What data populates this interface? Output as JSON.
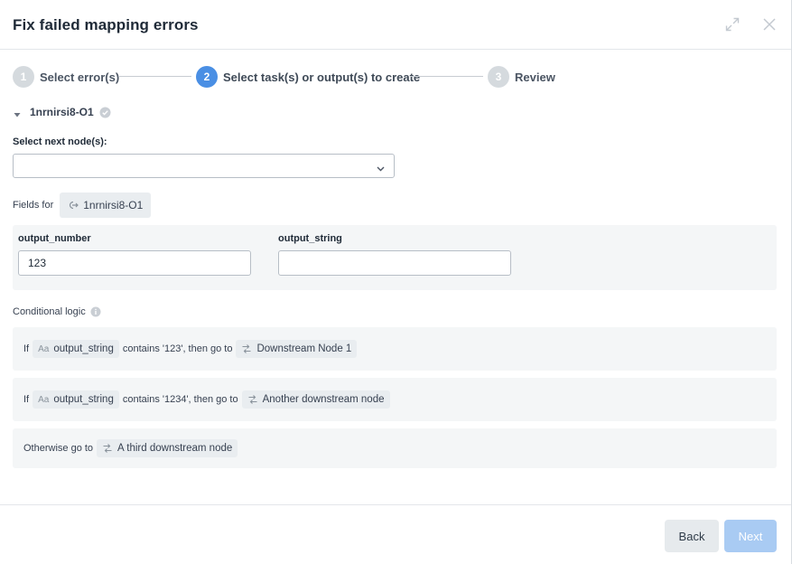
{
  "dialog": {
    "title": "Fix failed mapping errors",
    "expand_icon": "expand-icon",
    "close_icon": "close-icon"
  },
  "stepper": {
    "steps": [
      {
        "number": "1",
        "label": "Select error(s)",
        "state": "inactive"
      },
      {
        "number": "2",
        "label": "Select task(s) or output(s) to create",
        "state": "active"
      },
      {
        "number": "3",
        "label": "Review",
        "state": "inactive"
      }
    ],
    "active_color": "#4a8fe4",
    "inactive_color": "#d5dade"
  },
  "node": {
    "name": "1nrnirsi8-O1",
    "status_icon": "check-circle-icon",
    "select_next_label": "Select next node(s):",
    "select_next_value": "",
    "fields_for_label": "Fields for",
    "fields_for_chip": "1nrnirsi8-O1",
    "fields": [
      {
        "label": "output_number",
        "value": "123"
      },
      {
        "label": "output_string",
        "value": ""
      }
    ]
  },
  "conditional": {
    "title": "Conditional logic",
    "rules": [
      {
        "if": "If",
        "type_icon": "Aa",
        "field": "output_string",
        "condition": "contains '123', then go to",
        "target": "Downstream Node 1"
      },
      {
        "if": "If",
        "type_icon": "Aa",
        "field": "output_string",
        "condition": "contains '1234', then go to",
        "target": "Another downstream node"
      }
    ],
    "otherwise": {
      "text": "Otherwise go to",
      "target": "A third downstream node"
    }
  },
  "footer": {
    "back_label": "Back",
    "next_label": "Next"
  }
}
